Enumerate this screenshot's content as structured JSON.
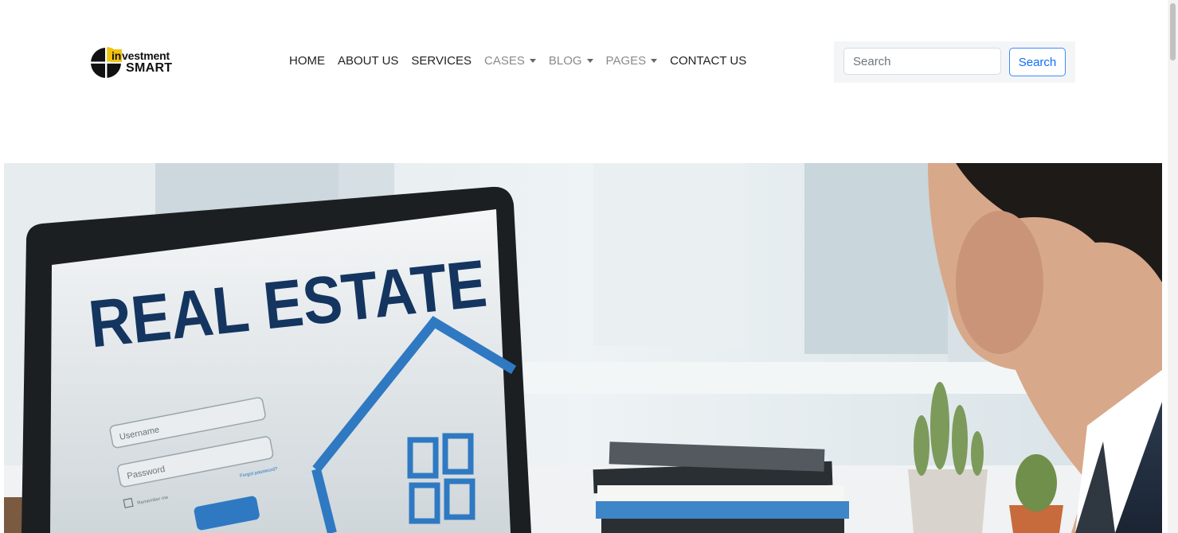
{
  "logo": {
    "line1_prefix": "in",
    "line1_rest": "vestment",
    "line2": "SMART"
  },
  "nav": {
    "items": [
      {
        "label": "HOME",
        "dropdown": false,
        "muted": false
      },
      {
        "label": "ABOUT US",
        "dropdown": false,
        "muted": false
      },
      {
        "label": "SERVICES",
        "dropdown": false,
        "muted": false
      },
      {
        "label": "CASES",
        "dropdown": true,
        "muted": true
      },
      {
        "label": "BLOG",
        "dropdown": true,
        "muted": true
      },
      {
        "label": "PAGES",
        "dropdown": true,
        "muted": true
      },
      {
        "label": "CONTACT US",
        "dropdown": false,
        "muted": false
      }
    ]
  },
  "search": {
    "placeholder": "Search",
    "button_label": "Search"
  },
  "hero": {
    "screen_heading": "REAL ESTATE",
    "username_placeholder": "Username",
    "password_placeholder": "Password",
    "forgot_link": "Forgot password?",
    "remember_label": "Remember me"
  },
  "colors": {
    "accent": "#0d6efd",
    "heading_navy": "#14355f",
    "house_blue": "#2f79c2",
    "logo_yellow": "#f1c40f"
  }
}
